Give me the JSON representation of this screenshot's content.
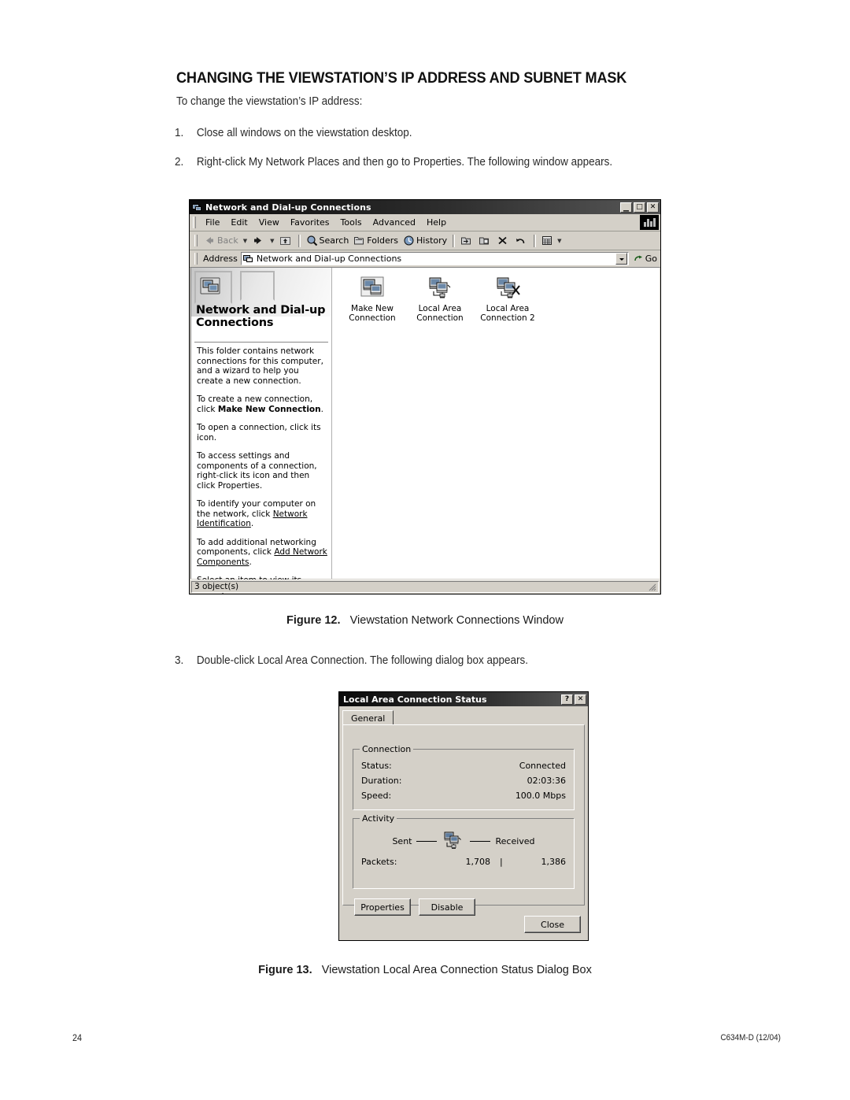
{
  "document": {
    "heading": "CHANGING THE VIEWSTATION’S IP ADDRESS AND SUBNET MASK",
    "intro": "To change the viewstation’s IP address:",
    "steps": [
      {
        "num": "1.",
        "text": "Close all windows on the viewstation desktop."
      },
      {
        "num": "2.",
        "text": "Right-click My Network Places and then go to Properties. The following window appears."
      },
      {
        "num": "3.",
        "text": "Double-click Local Area Connection. The following dialog box appears."
      }
    ],
    "figures": [
      {
        "label": "Figure 12.",
        "caption": "Viewstation Network Connections Window"
      },
      {
        "label": "Figure 13.",
        "caption": "Viewstation Local Area Connection Status Dialog Box"
      }
    ],
    "footer": {
      "page_number": "24",
      "doc_code": "C634M-D (12/04)"
    }
  },
  "explorer_window": {
    "title": "Network and Dial-up Connections",
    "window_buttons": {
      "minimize": "_",
      "maximize": "□",
      "close": "✕"
    },
    "menus": [
      "File",
      "Edit",
      "View",
      "Favorites",
      "Tools",
      "Advanced",
      "Help"
    ],
    "toolbar": {
      "back": "Back",
      "search": "Search",
      "folders": "Folders",
      "history": "History"
    },
    "address": {
      "label": "Address",
      "value": "Network and Dial-up Connections",
      "go": "Go"
    },
    "left_panel": {
      "title": "Network and Dial-up Connections",
      "paragraphs": [
        "This folder contains network connections for this computer, and a wizard to help you create a new connection.",
        "To create a new connection, click Make New Connection.",
        "To open a connection, click its icon.",
        "To access settings and components of a connection, right-click its icon and then click Properties.",
        "To identify your computer on the network, click Network Identification.",
        "To add additional networking components, click Add Network Components.",
        "Select an item to view its description."
      ],
      "bold_phrase": "Make New Connection",
      "links": [
        "Network Identification",
        "Add Network Components"
      ]
    },
    "connections": [
      {
        "name": "Make New Connection",
        "icon": "make-new-connection-icon"
      },
      {
        "name": "Local Area Connection",
        "icon": "local-area-connection-icon"
      },
      {
        "name": "Local Area Connection 2",
        "icon": "local-area-connection-disabled-icon"
      }
    ],
    "statusbar": "3 object(s)"
  },
  "status_dialog": {
    "title": "Local Area Connection Status",
    "titlebar_buttons": {
      "help": "?",
      "close": "✕"
    },
    "tabs": [
      "General"
    ],
    "connection_group": {
      "label": "Connection",
      "rows": [
        {
          "label": "Status:",
          "value": "Connected"
        },
        {
          "label": "Duration:",
          "value": "02:03:36"
        },
        {
          "label": "Speed:",
          "value": "100.0 Mbps"
        }
      ]
    },
    "activity_group": {
      "label": "Activity",
      "sent_label": "Sent",
      "received_label": "Received",
      "packets_label": "Packets:",
      "packets_sent": "1,708",
      "packets_received": "1,386",
      "separator": "|"
    },
    "buttons": {
      "properties": "Properties",
      "disable": "Disable",
      "close": "Close"
    }
  },
  "colors": {
    "window_face": "#d4d0c8",
    "titlebar_dark": "#0a0a0a",
    "text": "#000000",
    "page_background": "#ffffff"
  }
}
